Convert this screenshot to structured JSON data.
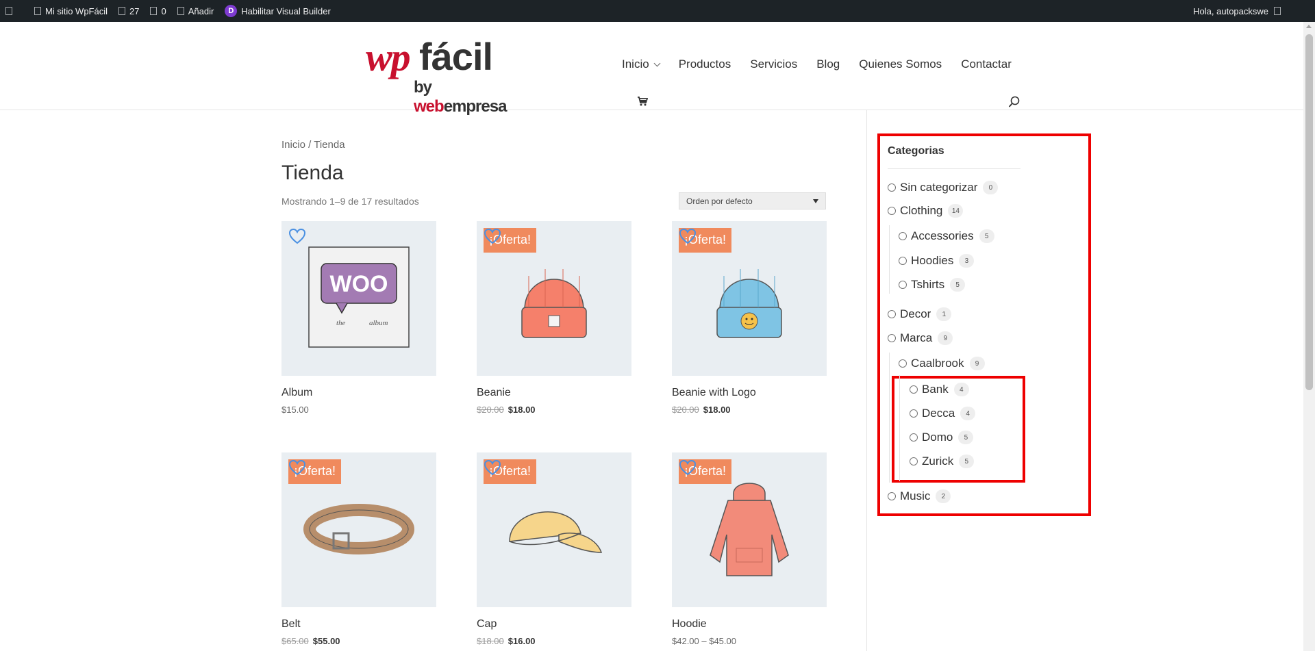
{
  "adminbar": {
    "site_name": "Mi sitio WpFácil",
    "updates_count": "27",
    "comments_count": "0",
    "add_new": "Añadir",
    "visual_builder": "Habilitar Visual Builder",
    "divi_letter": "D",
    "greeting": "Hola, autopackswe"
  },
  "logo": {
    "wp": "wp",
    "facil": "fácil",
    "by": "by ",
    "web": "web",
    "empresa": "empresa"
  },
  "nav": {
    "items": [
      "Inicio",
      "Productos",
      "Servicios",
      "Blog",
      "Quienes Somos",
      "Contactar"
    ]
  },
  "breadcrumb": "Inicio / Tienda",
  "page_title": "Tienda",
  "results_count": "Mostrando 1–9 de 17 resultados",
  "orderby": {
    "selected": "Orden por defecto"
  },
  "products": [
    {
      "name": "Album",
      "price": "$15.00",
      "old_price": "",
      "sale": false
    },
    {
      "name": "Beanie",
      "price": "$18.00",
      "old_price": "$20.00",
      "sale": true
    },
    {
      "name": "Beanie with Logo",
      "price": "$18.00",
      "old_price": "$20.00",
      "sale": true
    },
    {
      "name": "Belt",
      "price": "$55.00",
      "old_price": "$65.00",
      "sale": true
    },
    {
      "name": "Cap",
      "price": "$16.00",
      "old_price": "$18.00",
      "sale": true
    },
    {
      "name": "Hoodie",
      "price": "$42.00 – $45.00",
      "old_price": "",
      "sale": true
    }
  ],
  "sale_badge": "¡Oferta!",
  "album_art": {
    "brand": "WOO",
    "caption_left": "the",
    "caption_right": "album"
  },
  "sidebar": {
    "title": "Categorias",
    "categories": [
      {
        "label": "Sin categorizar",
        "count": "0"
      },
      {
        "label": "Clothing",
        "count": "14"
      },
      {
        "label": "Accessories",
        "count": "5"
      },
      {
        "label": "Hoodies",
        "count": "3"
      },
      {
        "label": "Tshirts",
        "count": "5"
      },
      {
        "label": "Decor",
        "count": "1"
      },
      {
        "label": "Marca",
        "count": "9"
      },
      {
        "label": "Caalbrook",
        "count": "9"
      },
      {
        "label": "Bank",
        "count": "4"
      },
      {
        "label": "Decca",
        "count": "4"
      },
      {
        "label": "Domo",
        "count": "5"
      },
      {
        "label": "Zurick",
        "count": "5"
      },
      {
        "label": "Music",
        "count": "2"
      }
    ]
  },
  "colors": {
    "admin_bar": "#1d2327",
    "accent_red": "#c8102e",
    "sale_badge": "#f08a5d",
    "highlight_border": "#ee0000",
    "heart": "#4a90e2"
  }
}
